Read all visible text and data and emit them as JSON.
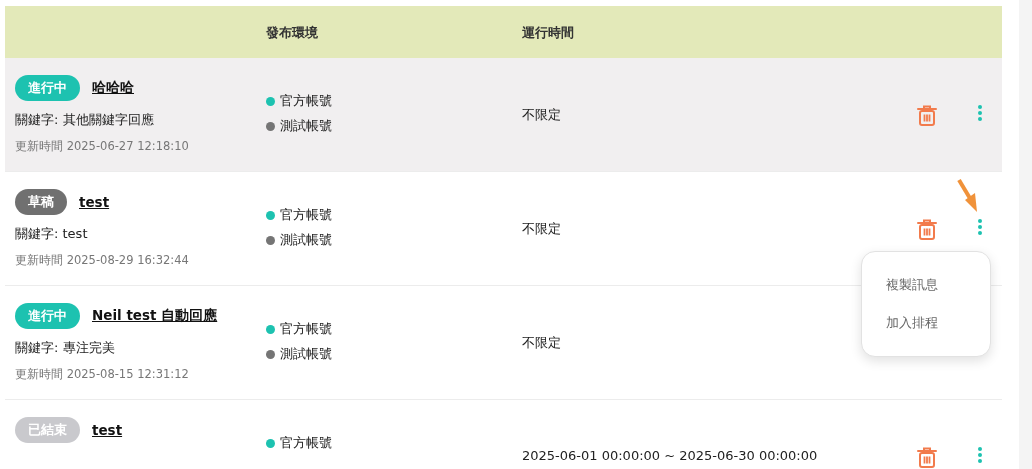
{
  "table": {
    "columns": [
      {
        "label": "發布環境"
      },
      {
        "label": "運行時間"
      }
    ],
    "rows": [
      {
        "status": {
          "label": "進行中",
          "color": "#1dc2b0"
        },
        "title": "哈哈哈",
        "keyword": "關鍵字: 其他關鍵字回應",
        "updated": "更新時間 2025-06-27 12:18:10",
        "environments": [
          {
            "label": "官方帳號",
            "color": "#1dc2b0"
          },
          {
            "label": "測試帳號",
            "color": "#757575"
          }
        ],
        "runtime": "不限定",
        "hovered": true
      },
      {
        "status": {
          "label": "草稿",
          "color": "#707070"
        },
        "title": "test",
        "keyword": "關鍵字: test",
        "updated": "更新時間 2025-08-29 16:32:44",
        "environments": [
          {
            "label": "官方帳號",
            "color": "#1dc2b0"
          },
          {
            "label": "測試帳號",
            "color": "#757575"
          }
        ],
        "runtime": "不限定",
        "hovered": false,
        "menu": [
          "複製訊息",
          "加入排程"
        ]
      },
      {
        "status": {
          "label": "進行中",
          "color": "#1dc2b0"
        },
        "title": "Neil test  自動回應",
        "keyword": "關鍵字: 專注完美",
        "updated": "更新時間 2025-08-15 12:31:12",
        "environments": [
          {
            "label": "官方帳號",
            "color": "#1dc2b0"
          },
          {
            "label": "測試帳號",
            "color": "#757575"
          }
        ],
        "runtime": "不限定",
        "hovered": false
      },
      {
        "status": {
          "label": "已結束",
          "color": "#c9c9cd"
        },
        "title": "test",
        "environments": [
          {
            "label": "官方帳號",
            "color": "#1dc2b0"
          }
        ],
        "runtime": "2025-06-01 00:00:00 ~ 2025-06-30 00:00:00",
        "hovered": false
      }
    ]
  }
}
